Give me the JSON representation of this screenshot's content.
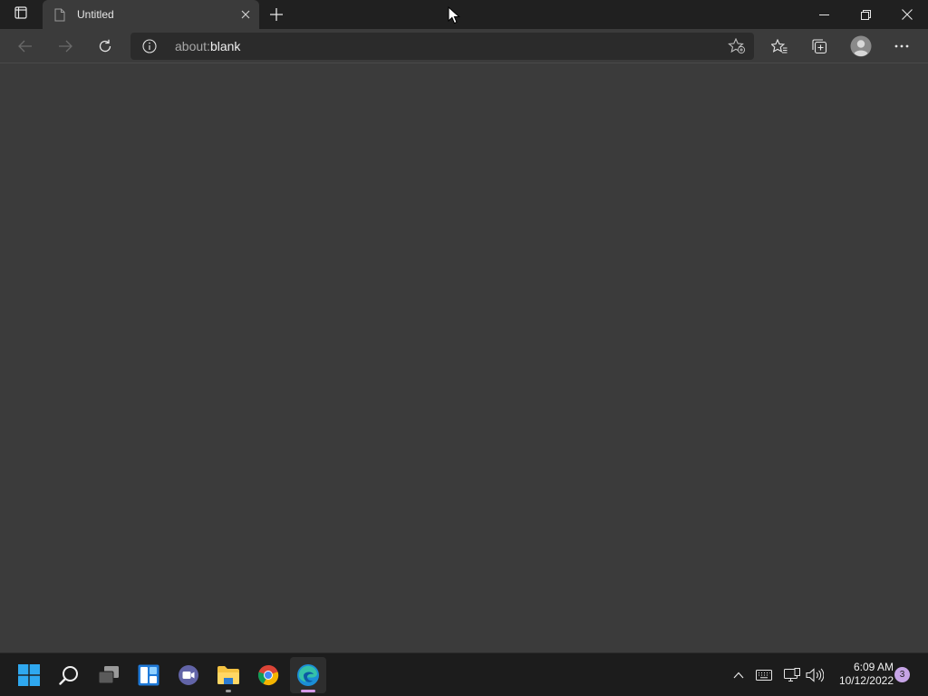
{
  "browser": {
    "tab": {
      "title": "Untitled",
      "favicon": "page-icon",
      "close_icon": "close-icon"
    },
    "new_tab_icon": "plus-icon",
    "tab_actions_icon": "tab-actions-icon",
    "window_controls": [
      "minimize-icon",
      "restore-icon",
      "close-icon"
    ]
  },
  "toolbar": {
    "back_icon": "arrow-left-icon",
    "forward_icon": "arrow-right-icon",
    "refresh_icon": "refresh-icon",
    "address": {
      "scheme": "about:",
      "rest": "blank",
      "info_icon": "info-icon",
      "add_favorite_icon": "star-plus-icon"
    },
    "favorites_icon": "favorites-icon",
    "collections_icon": "collections-icon",
    "profile_icon": "avatar-icon",
    "more_icon": "more-icon"
  },
  "taskbar": {
    "apps": [
      "windows-start-icon",
      "search-icon",
      "task-view-icon",
      "widgets-icon",
      "teams-chat-icon",
      "file-explorer-icon",
      "chrome-icon",
      "edge-icon"
    ],
    "tray": [
      "chevron-up-icon",
      "keyboard-icon",
      "network-icon",
      "volume-icon"
    ],
    "time": "6:09 AM",
    "date": "10/12/2022",
    "notification_count": "3"
  },
  "colors": {
    "titlebar": "#202020",
    "page_bg": "#3b3b3b",
    "taskbar": "#1c1c1c",
    "edge_indicator": "#d59ae9"
  }
}
